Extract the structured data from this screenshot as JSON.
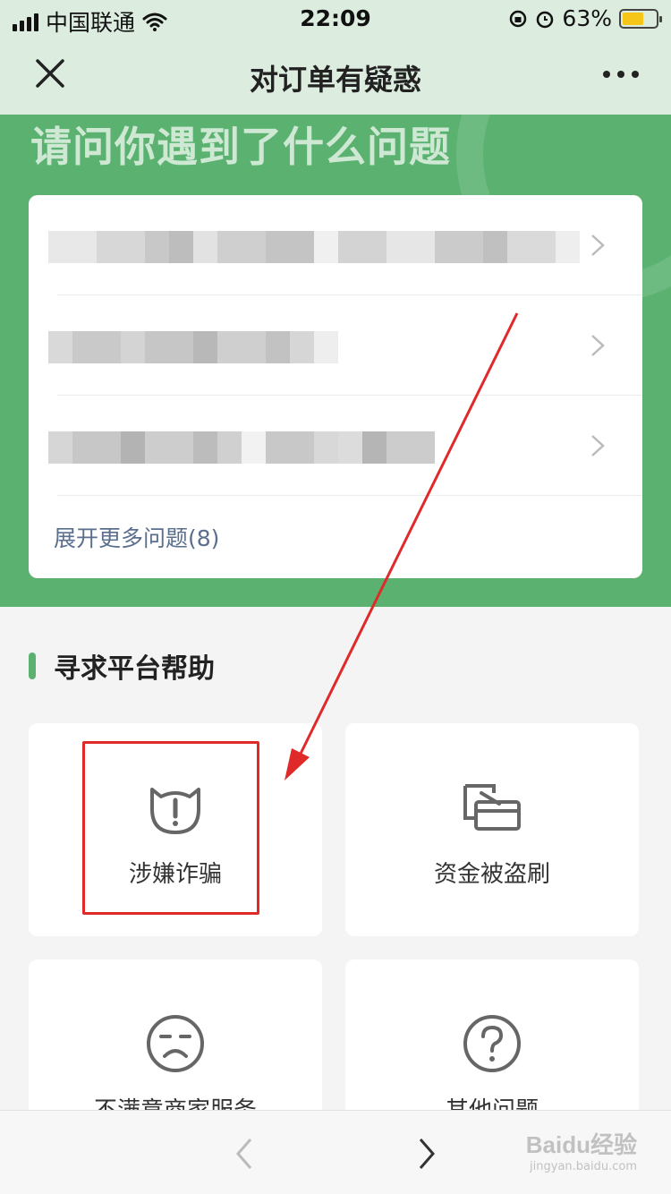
{
  "status_bar": {
    "carrier": "中国联通",
    "time": "22:09",
    "battery_percent": "63%",
    "battery_level": 0.63
  },
  "nav": {
    "title": "对订单有疑惑"
  },
  "hero": {
    "headline": "请问你遇到了什么问题"
  },
  "questions": {
    "expand_label": "展开更多问题(8)"
  },
  "help_section": {
    "title": "寻求平台帮助",
    "tiles": [
      {
        "label": "涉嫌诈骗",
        "icon": "warning-cat-icon"
      },
      {
        "label": "资金被盗刷",
        "icon": "card-swipe-icon"
      },
      {
        "label": "不满意商家服务",
        "icon": "sad-face-icon"
      },
      {
        "label": "其他问题",
        "icon": "question-circle-icon"
      }
    ]
  },
  "watermark": {
    "brand": "Baidu经验",
    "url": "jingyan.baidu.com"
  },
  "colors": {
    "accent_green": "#5bb270",
    "nav_bg": "#dcecdf",
    "highlight_red": "#e02a2a",
    "link_blue": "#5a6f8e"
  }
}
